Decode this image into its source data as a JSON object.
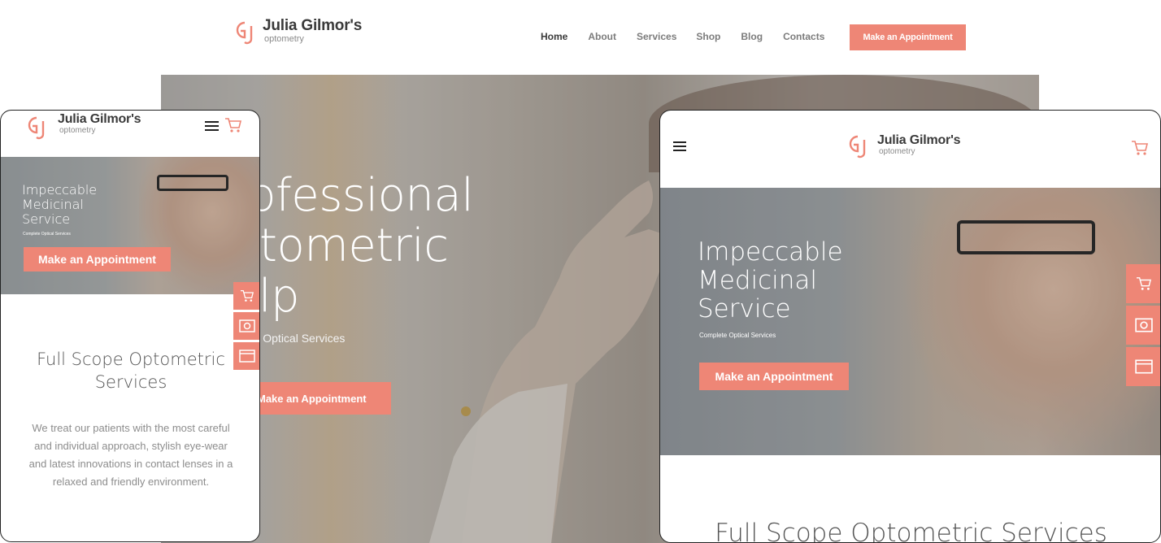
{
  "brand": {
    "name": "Julia Gilmor's",
    "sub": "optometry",
    "accent": "#ee8676"
  },
  "desktop": {
    "nav": [
      "Home",
      "About",
      "Services",
      "Shop",
      "Blog",
      "Contacts"
    ],
    "cta": "Make an Appointment",
    "hero": {
      "title_lines": [
        "rofessional",
        "ptometric",
        "elp"
      ],
      "subtitle": "plete Optical Services",
      "cta": "Make an Appointment"
    }
  },
  "mobile": {
    "hero": {
      "title_lines": [
        "Impeccable",
        "Medicinal",
        "Service"
      ],
      "subtitle": "Complete Optical Services",
      "cta": "Make an Appointment"
    },
    "section_title_lines": [
      "Full Scope Optometric",
      "Services"
    ],
    "section_text": "We treat our patients with the most careful and individual approach, stylish eye-wear and latest innovations in contact lenses in a relaxed and friendly environment."
  },
  "tablet": {
    "hero": {
      "title_lines": [
        "Impeccable",
        "Medicinal",
        "Service"
      ],
      "subtitle": "Complete Optical Services",
      "cta": "Make an Appointment"
    },
    "section_title": "Full Scope Optometric Services"
  },
  "icons": [
    "gj-logo-icon",
    "menu-icon",
    "cart-icon",
    "cart-widget-icon",
    "image-widget-icon",
    "window-widget-icon"
  ]
}
